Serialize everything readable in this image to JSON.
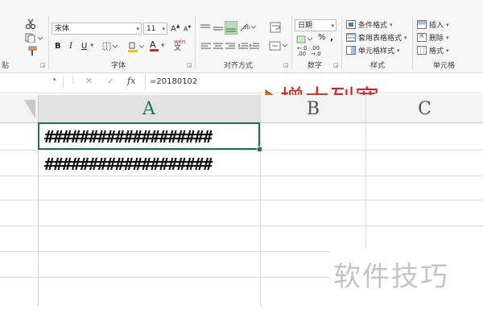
{
  "ribbon": {
    "clipboard": {
      "label": "贴"
    },
    "font": {
      "name": "宋体",
      "size": "11",
      "grow": "A",
      "shrink": "A",
      "bold": "B",
      "italic": "I",
      "underline": "U",
      "font_color_letter": "A",
      "phonetic_label": "wén",
      "label": "字体"
    },
    "alignment": {
      "label": "对齐方式"
    },
    "number": {
      "format": "日期",
      "percent": "%",
      "comma": ",",
      "label": "数字"
    },
    "styles": {
      "conditional": "条件格式",
      "table": "套用表格格式",
      "cell_styles": "单元格样式",
      "label": "样式"
    },
    "cells": {
      "insert": "插入",
      "delete": "删除",
      "format": "格式",
      "label": "单元格"
    }
  },
  "formula_bar": {
    "fx": "fx",
    "content": "=20180102"
  },
  "annotation": {
    "text": "增大列宽",
    "arrow_color": "#e8652b",
    "text_color": "#d62424"
  },
  "sheet": {
    "columns": [
      "A",
      "B",
      "C"
    ],
    "rows": [
      {
        "a": "###################"
      },
      {
        "a": "###################"
      }
    ]
  },
  "watermark": {
    "text": "软件技巧"
  },
  "colors": {
    "selection_green": "#217346",
    "conditional_icon": "#4a7fb5"
  }
}
